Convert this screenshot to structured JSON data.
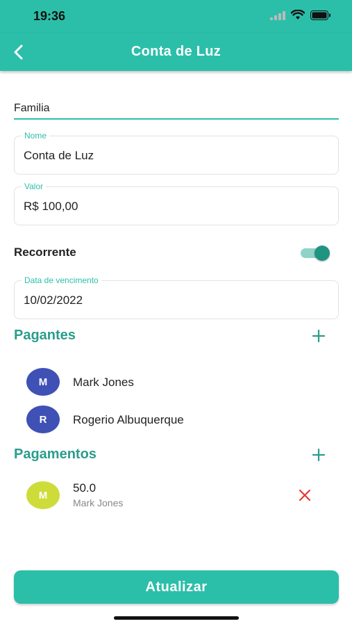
{
  "status_bar": {
    "time": "19:36",
    "icons": [
      "signal-icon",
      "wifi-icon",
      "battery-icon"
    ]
  },
  "header": {
    "title": "Conta de Luz",
    "back_icon": "chevron-left-icon"
  },
  "form": {
    "group_value": "Familia",
    "name_label": "Nome",
    "name_value": "Conta de Luz",
    "amount_label": "Valor",
    "amount_value": "R$ 100,00",
    "recurring_label": "Recorrente",
    "recurring_on": true,
    "due_label": "Data de vencimento",
    "due_value": "10/02/2022"
  },
  "payers": {
    "title": "Pagantes",
    "items": [
      {
        "initial": "M",
        "name": "Mark Jones"
      },
      {
        "initial": "R",
        "name": "Rogerio Albuquerque"
      }
    ]
  },
  "payments": {
    "title": "Pagamentos",
    "items": [
      {
        "initial": "M",
        "amount": "50.0",
        "payer": "Mark Jones"
      }
    ]
  },
  "actions": {
    "submit_label": "Atualizar"
  },
  "colors": {
    "primary": "#2bbfa9",
    "section_title": "#2a9d8b",
    "avatar_blue": "#3f51b5",
    "avatar_lime": "#cddc39",
    "remove": "#e53935"
  }
}
